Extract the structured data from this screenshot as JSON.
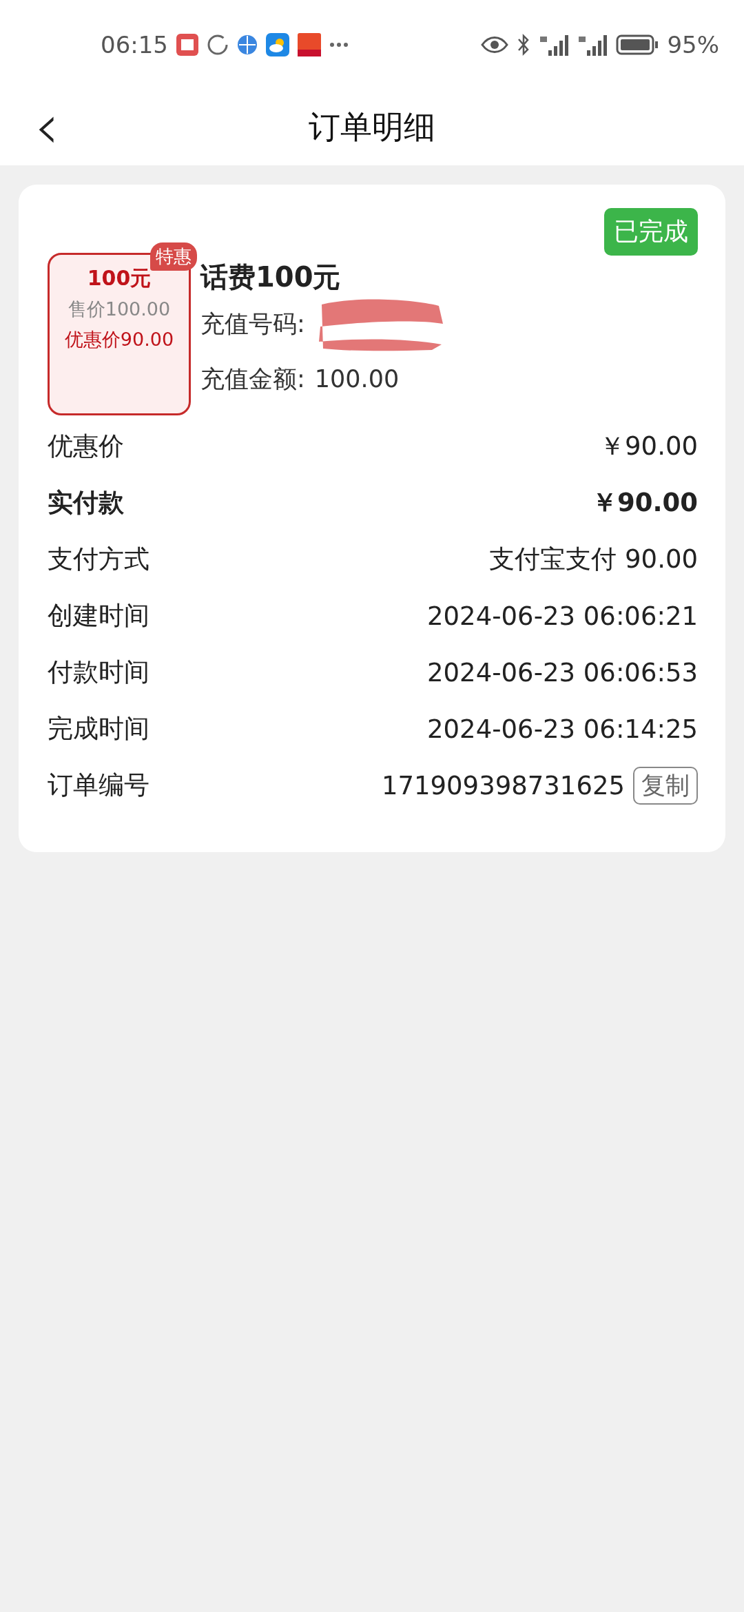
{
  "status_bar": {
    "time": "06:15",
    "battery": "95%"
  },
  "header": {
    "back": "‹",
    "title": "订单明细"
  },
  "order": {
    "status": "已完成",
    "product_tile": {
      "tag": "特惠",
      "amount": "100元",
      "sale_price": "售价100.00",
      "discount_price": "优惠价90.00"
    },
    "name": "话费100元",
    "recharge_number_label": "充值号码:",
    "recharge_amount_label": "充值金额:",
    "recharge_amount": "100.00",
    "rows": [
      {
        "label": "优惠价",
        "value": "￥90.00",
        "kind": "plain"
      },
      {
        "label": "实付款",
        "value": "￥90.00",
        "kind": "bold"
      },
      {
        "label": "支付方式",
        "value": "支付宝支付 90.00",
        "kind": "plain"
      },
      {
        "label": "创建时间",
        "value": "2024-06-23 06:06:21",
        "kind": "plain"
      },
      {
        "label": "付款时间",
        "value": "2024-06-23 06:06:53",
        "kind": "plain"
      },
      {
        "label": "完成时间",
        "value": "2024-06-23 06:14:25",
        "kind": "plain"
      },
      {
        "label": "订单编号",
        "value": "171909398731625",
        "kind": "copy",
        "button": "复制"
      }
    ]
  }
}
